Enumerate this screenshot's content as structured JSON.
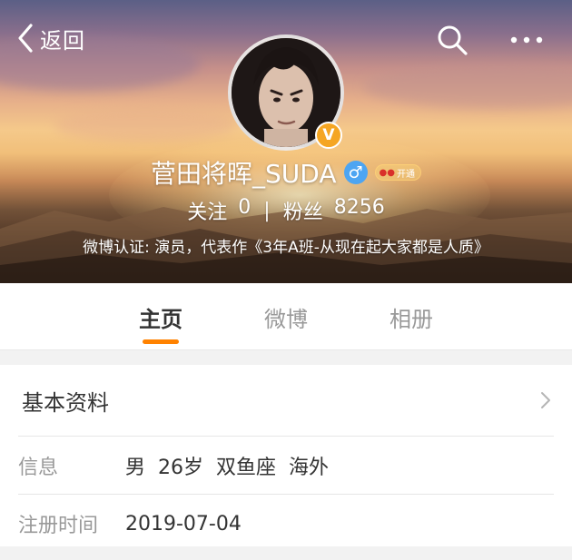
{
  "header": {
    "back_label": "返回",
    "user": {
      "name": "菅田将晖_SUDA",
      "verified_badge": "V",
      "gender_icon": "male-icon",
      "gender_symbol": "♂",
      "vip_icon": "membership-icon",
      "vip_label": "开通",
      "following_label": "关注",
      "following_count": "0",
      "separator": "|",
      "followers_label": "粉丝",
      "followers_count": "8256",
      "bio": "微博认证: 演员，代表作《3年A班-从现在起大家都是人质》"
    }
  },
  "tabs": [
    {
      "label": "主页",
      "active": true
    },
    {
      "label": "微博",
      "active": false
    },
    {
      "label": "相册",
      "active": false
    }
  ],
  "info_card": {
    "title": "基本资料",
    "rows": [
      {
        "label": "信息",
        "value": "男  26岁  双鱼座  海外"
      },
      {
        "label": "注册时间",
        "value": "2019-07-04"
      }
    ]
  },
  "colors": {
    "accent": "#ff8200",
    "verified": "#f5a623",
    "gender": "#4da5f2"
  }
}
